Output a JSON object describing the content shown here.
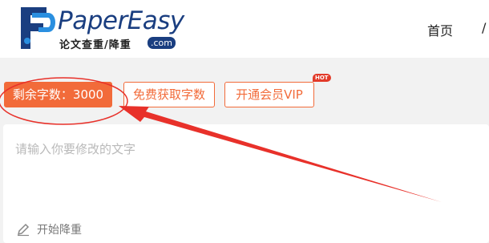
{
  "header": {
    "logo_name": "PaperEasy",
    "logo_subtitle": "论文查重/降重",
    "logo_domain": ".com",
    "nav_home": "首页",
    "nav_next_partial": "/"
  },
  "actions": {
    "remaining_label": "剩余字数：3000",
    "free_words_label": "免费获取字数",
    "vip_label": "开通会员VIP",
    "vip_badge": "HOT"
  },
  "editor": {
    "placeholder": "请输入你要修改的文字",
    "start_label": "开始降重"
  },
  "colors": {
    "accent": "#f26b3a",
    "brand": "#1a3e80",
    "annotation": "#e8312a"
  }
}
